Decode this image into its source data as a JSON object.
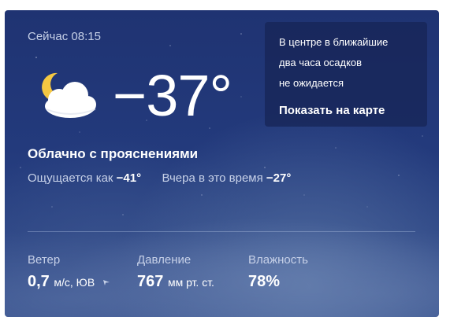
{
  "now": {
    "label": "Сейчас 08:15"
  },
  "current": {
    "icon": "moon-cloud-icon",
    "temperature": "−37°",
    "condition": "Облачно с прояснениями",
    "feels_like_label": "Ощущается как",
    "feels_like_value": "−41°",
    "yesterday_label": "Вчера в это время",
    "yesterday_value": "−27°"
  },
  "precipitation": {
    "lines": [
      "В центре в ближайшие",
      "два часа осадков",
      "не ожидается"
    ],
    "map_link": "Показать на карте"
  },
  "stats": {
    "wind": {
      "label": "Ветер",
      "value": "0,7",
      "unit": "м/с, ЮВ",
      "icon": "wind-direction-icon"
    },
    "pressure": {
      "label": "Давление",
      "value": "767",
      "unit": "мм рт. ст."
    },
    "humidity": {
      "label": "Влажность",
      "value": "78%"
    }
  },
  "colors": {
    "card_bg": "#233a7c",
    "text_primary": "#ffffff",
    "text_secondary": "#c7d1e8",
    "moon": "#f5c842"
  }
}
